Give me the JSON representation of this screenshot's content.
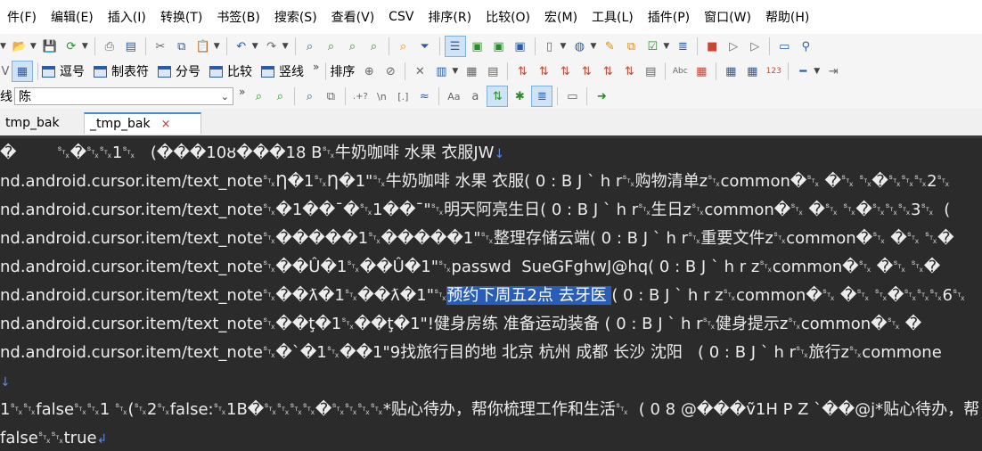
{
  "menu": [
    "件(F)",
    "编辑(E)",
    "插入(I)",
    "转换(T)",
    "书签(B)",
    "搜索(S)",
    "查看(V)",
    "CSV",
    "排序(R)",
    "比较(O)",
    "宏(M)",
    "工具(L)",
    "插件(P)",
    "窗口(W)",
    "帮助(H)"
  ],
  "toolbar2": {
    "items": [
      "逗号",
      "制表符",
      "分号",
      "比较",
      "竖线"
    ],
    "sort_label": "排序"
  },
  "toolbar3": {
    "search_prefix": "线",
    "search_value": "陈",
    "regex_label": ".+?",
    "newline_label": "\\n",
    "bracket_label": "[.]",
    "case_label": "Aa"
  },
  "tabs": [
    {
      "label": "tmp_bak",
      "active": false
    },
    {
      "label": "_tmp_bak",
      "active": true,
      "close": "×"
    }
  ],
  "editor": {
    "lines": [
      "�        ␂�␂␂1␂   (���10ȣ���18 B␂牛奶咖啡 水果 衣服JW",
      "nd.android.cursor.item/text_note␂Ƞ�1␂Ƞ�1\"␂牛奶咖啡 水果 衣服( 0 : B J ` h r␂购物清单z␂common�␂ �␂ ␂�␂␂␂2␂",
      "nd.android.cursor.item/text_note␂�1��¯�␂1��¯\"␂明天阿亮生日( 0 : B J ` h r␂生日z␂common�␂ �␂ ␂�␂␂␂3␂  (",
      "nd.android.cursor.item/text_note␂�����1␂�����1\"␂整理存储云端( 0 : B J ` h r␂重要文件z␂common�␂ �␂ ␂�",
      "nd.android.cursor.item/text_note␂��Û�1␂��Û�1\"␂passwd  SueGFghwJ@hq( 0 : B J ` h r z␂common�␂ �␂ ␂�",
      "nd.android.cursor.item/text_note␂��ƛ�1␂��ƛ�1\"␂",
      "nd.android.cursor.item/text_note␂��ţ�1␂��ţ�1\"!健身房练 准备运动装备 ( 0 : B J ` h r␂健身提示z␂common�␂ �",
      "nd.android.cursor.item/text_note␂�`�1␂��1\"9找旅行目的地 北京 杭州 成都 长沙 沈阳   ( 0 : B J ` h r␂旅行z␂commone",
      "",
      "1␂␂false␂␂1 ␂(␂2␂false:␂1B�␂␂␂␂�␂␂␂␂*贴心待办，帮你梳理工作和生活␂  ( 0 8 @���ṽ1H P Z `��@j*贴心待办，帮",
      "false␂␂true"
    ],
    "selected_text": "预约下周五2点 去牙医 ",
    "after_selected": "( 0 : B J ` h r z␂common�␂ �␂ ␂�␂␂␂6␂"
  }
}
